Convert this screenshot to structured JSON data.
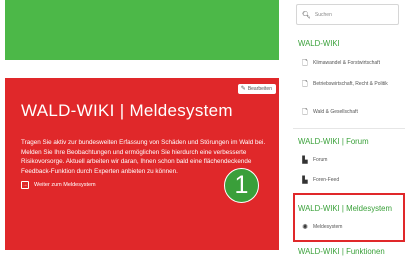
{
  "hero": {
    "edit_label": "Bearbeiten",
    "title": "WALD-WIKI | Meldesystem",
    "text": "Tragen Sie aktiv zur bundesweiten Erfassung von Schäden und Störungen im Wald bei. Melden Sie Ihre Beobachtungen und ermöglichen Sie hierdurch eine verbesserte Risikovorsorge. Aktuell arbeiten wir daran, Ihnen schon bald eine flächendeckende Feedback-Funktion durch Experten anbieten zu können.",
    "link_label": "Weiter zum Meldesystem",
    "badge": "1"
  },
  "sidebar": {
    "search_placeholder": "Suchen",
    "sections": [
      {
        "title": "WALD-WIKI",
        "items": [
          {
            "label": "Klimawandel & Forstwirtschaft",
            "icon": "document-icon"
          },
          {
            "label": "Betriebswirtschaft, Recht & Politik",
            "icon": "document-icon"
          },
          {
            "label": "Wald & Gesellschaft",
            "icon": "document-icon"
          }
        ]
      },
      {
        "title": "WALD-WIKI | Forum",
        "items": [
          {
            "label": "Forum",
            "icon": "chat-icon"
          },
          {
            "label": "Foren-Feed",
            "icon": "chat-icon"
          }
        ]
      },
      {
        "title": "WALD-WIKI | Meldesystem",
        "items": [
          {
            "label": "Meldesystem",
            "icon": "alert-icon"
          }
        ]
      },
      {
        "title": "WALD-WIKI | Funktionen",
        "items": []
      }
    ]
  },
  "colors": {
    "green": "#4cb848",
    "red": "#e0282a",
    "section_title": "#3aa13a"
  }
}
